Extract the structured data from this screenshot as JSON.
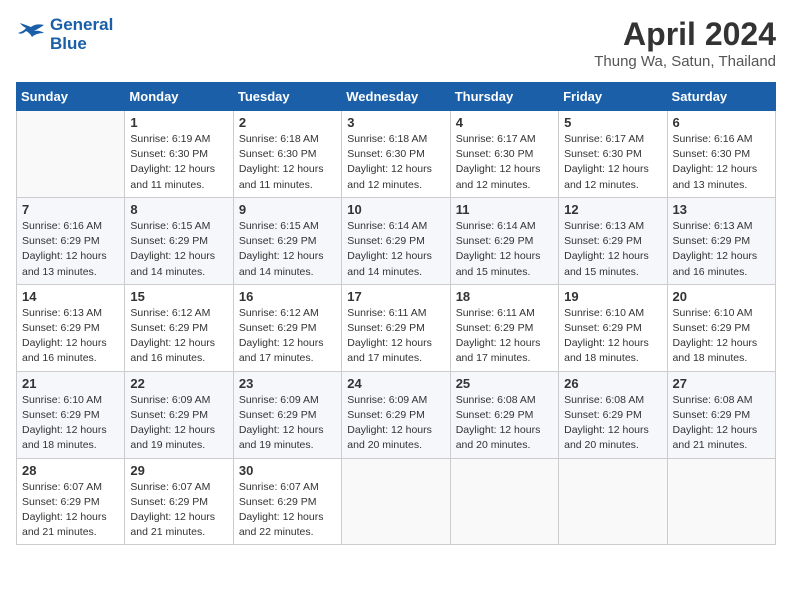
{
  "header": {
    "logo_line1": "General",
    "logo_line2": "Blue",
    "month": "April 2024",
    "location": "Thung Wa, Satun, Thailand"
  },
  "days_of_week": [
    "Sunday",
    "Monday",
    "Tuesday",
    "Wednesday",
    "Thursday",
    "Friday",
    "Saturday"
  ],
  "weeks": [
    [
      {
        "num": "",
        "info": ""
      },
      {
        "num": "1",
        "info": "Sunrise: 6:19 AM\nSunset: 6:30 PM\nDaylight: 12 hours\nand 11 minutes."
      },
      {
        "num": "2",
        "info": "Sunrise: 6:18 AM\nSunset: 6:30 PM\nDaylight: 12 hours\nand 11 minutes."
      },
      {
        "num": "3",
        "info": "Sunrise: 6:18 AM\nSunset: 6:30 PM\nDaylight: 12 hours\nand 12 minutes."
      },
      {
        "num": "4",
        "info": "Sunrise: 6:17 AM\nSunset: 6:30 PM\nDaylight: 12 hours\nand 12 minutes."
      },
      {
        "num": "5",
        "info": "Sunrise: 6:17 AM\nSunset: 6:30 PM\nDaylight: 12 hours\nand 12 minutes."
      },
      {
        "num": "6",
        "info": "Sunrise: 6:16 AM\nSunset: 6:30 PM\nDaylight: 12 hours\nand 13 minutes."
      }
    ],
    [
      {
        "num": "7",
        "info": "Sunrise: 6:16 AM\nSunset: 6:29 PM\nDaylight: 12 hours\nand 13 minutes."
      },
      {
        "num": "8",
        "info": "Sunrise: 6:15 AM\nSunset: 6:29 PM\nDaylight: 12 hours\nand 14 minutes."
      },
      {
        "num": "9",
        "info": "Sunrise: 6:15 AM\nSunset: 6:29 PM\nDaylight: 12 hours\nand 14 minutes."
      },
      {
        "num": "10",
        "info": "Sunrise: 6:14 AM\nSunset: 6:29 PM\nDaylight: 12 hours\nand 14 minutes."
      },
      {
        "num": "11",
        "info": "Sunrise: 6:14 AM\nSunset: 6:29 PM\nDaylight: 12 hours\nand 15 minutes."
      },
      {
        "num": "12",
        "info": "Sunrise: 6:13 AM\nSunset: 6:29 PM\nDaylight: 12 hours\nand 15 minutes."
      },
      {
        "num": "13",
        "info": "Sunrise: 6:13 AM\nSunset: 6:29 PM\nDaylight: 12 hours\nand 16 minutes."
      }
    ],
    [
      {
        "num": "14",
        "info": "Sunrise: 6:13 AM\nSunset: 6:29 PM\nDaylight: 12 hours\nand 16 minutes."
      },
      {
        "num": "15",
        "info": "Sunrise: 6:12 AM\nSunset: 6:29 PM\nDaylight: 12 hours\nand 16 minutes."
      },
      {
        "num": "16",
        "info": "Sunrise: 6:12 AM\nSunset: 6:29 PM\nDaylight: 12 hours\nand 17 minutes."
      },
      {
        "num": "17",
        "info": "Sunrise: 6:11 AM\nSunset: 6:29 PM\nDaylight: 12 hours\nand 17 minutes."
      },
      {
        "num": "18",
        "info": "Sunrise: 6:11 AM\nSunset: 6:29 PM\nDaylight: 12 hours\nand 17 minutes."
      },
      {
        "num": "19",
        "info": "Sunrise: 6:10 AM\nSunset: 6:29 PM\nDaylight: 12 hours\nand 18 minutes."
      },
      {
        "num": "20",
        "info": "Sunrise: 6:10 AM\nSunset: 6:29 PM\nDaylight: 12 hours\nand 18 minutes."
      }
    ],
    [
      {
        "num": "21",
        "info": "Sunrise: 6:10 AM\nSunset: 6:29 PM\nDaylight: 12 hours\nand 18 minutes."
      },
      {
        "num": "22",
        "info": "Sunrise: 6:09 AM\nSunset: 6:29 PM\nDaylight: 12 hours\nand 19 minutes."
      },
      {
        "num": "23",
        "info": "Sunrise: 6:09 AM\nSunset: 6:29 PM\nDaylight: 12 hours\nand 19 minutes."
      },
      {
        "num": "24",
        "info": "Sunrise: 6:09 AM\nSunset: 6:29 PM\nDaylight: 12 hours\nand 20 minutes."
      },
      {
        "num": "25",
        "info": "Sunrise: 6:08 AM\nSunset: 6:29 PM\nDaylight: 12 hours\nand 20 minutes."
      },
      {
        "num": "26",
        "info": "Sunrise: 6:08 AM\nSunset: 6:29 PM\nDaylight: 12 hours\nand 20 minutes."
      },
      {
        "num": "27",
        "info": "Sunrise: 6:08 AM\nSunset: 6:29 PM\nDaylight: 12 hours\nand 21 minutes."
      }
    ],
    [
      {
        "num": "28",
        "info": "Sunrise: 6:07 AM\nSunset: 6:29 PM\nDaylight: 12 hours\nand 21 minutes."
      },
      {
        "num": "29",
        "info": "Sunrise: 6:07 AM\nSunset: 6:29 PM\nDaylight: 12 hours\nand 21 minutes."
      },
      {
        "num": "30",
        "info": "Sunrise: 6:07 AM\nSunset: 6:29 PM\nDaylight: 12 hours\nand 22 minutes."
      },
      {
        "num": "",
        "info": ""
      },
      {
        "num": "",
        "info": ""
      },
      {
        "num": "",
        "info": ""
      },
      {
        "num": "",
        "info": ""
      }
    ]
  ]
}
